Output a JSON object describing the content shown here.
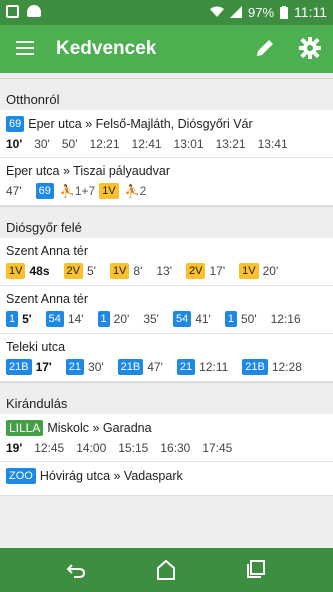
{
  "status": {
    "battery": "97%",
    "time": "11:11"
  },
  "appbar": {
    "title": "Kedvencek"
  },
  "sections": [
    {
      "title": "Otthonról",
      "cards": [
        {
          "route": {
            "badge": "69",
            "badge_color": "blue",
            "text": "Eper utca » Felső-Majláth, Diósgyőri Vár"
          },
          "times": [
            "10'",
            "30'",
            "50'",
            "12:21",
            "12:41",
            "13:01",
            "13:21",
            "13:41"
          ]
        },
        {
          "route": {
            "text": "Eper utca » Tiszai pályaudvar"
          },
          "row2": [
            {
              "t": "47'"
            },
            {
              "b": "69",
              "c": "blue"
            },
            {
              "w": "1+7"
            },
            {
              "b": "1V",
              "c": "yellow"
            },
            {
              "w": "2"
            }
          ]
        }
      ]
    },
    {
      "title": "Diósgyőr felé",
      "cards": [
        {
          "route": {
            "text": "Szent Anna tér"
          },
          "row2": [
            {
              "b": "1V",
              "c": "yellow"
            },
            {
              "t": "48s",
              "bold": true
            },
            {
              "b": "2V",
              "c": "yellow"
            },
            {
              "t": "5'"
            },
            {
              "b": "1V",
              "c": "yellow"
            },
            {
              "t": "8'"
            },
            {
              "t": "13'"
            },
            {
              "b": "2V",
              "c": "yellow"
            },
            {
              "t": "17'"
            },
            {
              "b": "1V",
              "c": "yellow"
            },
            {
              "t": "20'"
            }
          ]
        },
        {
          "route": {
            "text": "Szent Anna tér"
          },
          "row2": [
            {
              "b": "1",
              "c": "blue"
            },
            {
              "t": "5'",
              "bold": true
            },
            {
              "b": "54",
              "c": "blue"
            },
            {
              "t": "14'"
            },
            {
              "b": "1",
              "c": "blue"
            },
            {
              "t": "20'"
            },
            {
              "t": "35'"
            },
            {
              "b": "54",
              "c": "blue"
            },
            {
              "t": "41'"
            },
            {
              "b": "1",
              "c": "blue"
            },
            {
              "t": "50'"
            },
            {
              "t": "12:16"
            }
          ]
        },
        {
          "route": {
            "text": "Teleki utca"
          },
          "row2": [
            {
              "b": "21B",
              "c": "blue"
            },
            {
              "t": "17'",
              "bold": true
            },
            {
              "b": "21",
              "c": "blue"
            },
            {
              "t": "30'"
            },
            {
              "b": "21B",
              "c": "blue"
            },
            {
              "t": "47'"
            },
            {
              "b": "21",
              "c": "blue"
            },
            {
              "t": "12:11"
            },
            {
              "b": "21B",
              "c": "blue"
            },
            {
              "t": "12:28"
            }
          ]
        }
      ]
    },
    {
      "title": "Kirándulás",
      "cards": [
        {
          "route": {
            "badge": "LILLA",
            "badge_color": "green",
            "text": "Miskolc » Garadna"
          },
          "times": [
            "19'",
            "12:45",
            "14:00",
            "15:15",
            "16:30",
            "17:45"
          ]
        },
        {
          "route": {
            "badge": "ZOO",
            "badge_color": "blue",
            "text": "Hóvirág utca » Vadaspark"
          },
          "times": []
        }
      ]
    }
  ],
  "navbar": {
    "back": "back-icon",
    "home": "home-icon",
    "recents": "recents-icon"
  }
}
